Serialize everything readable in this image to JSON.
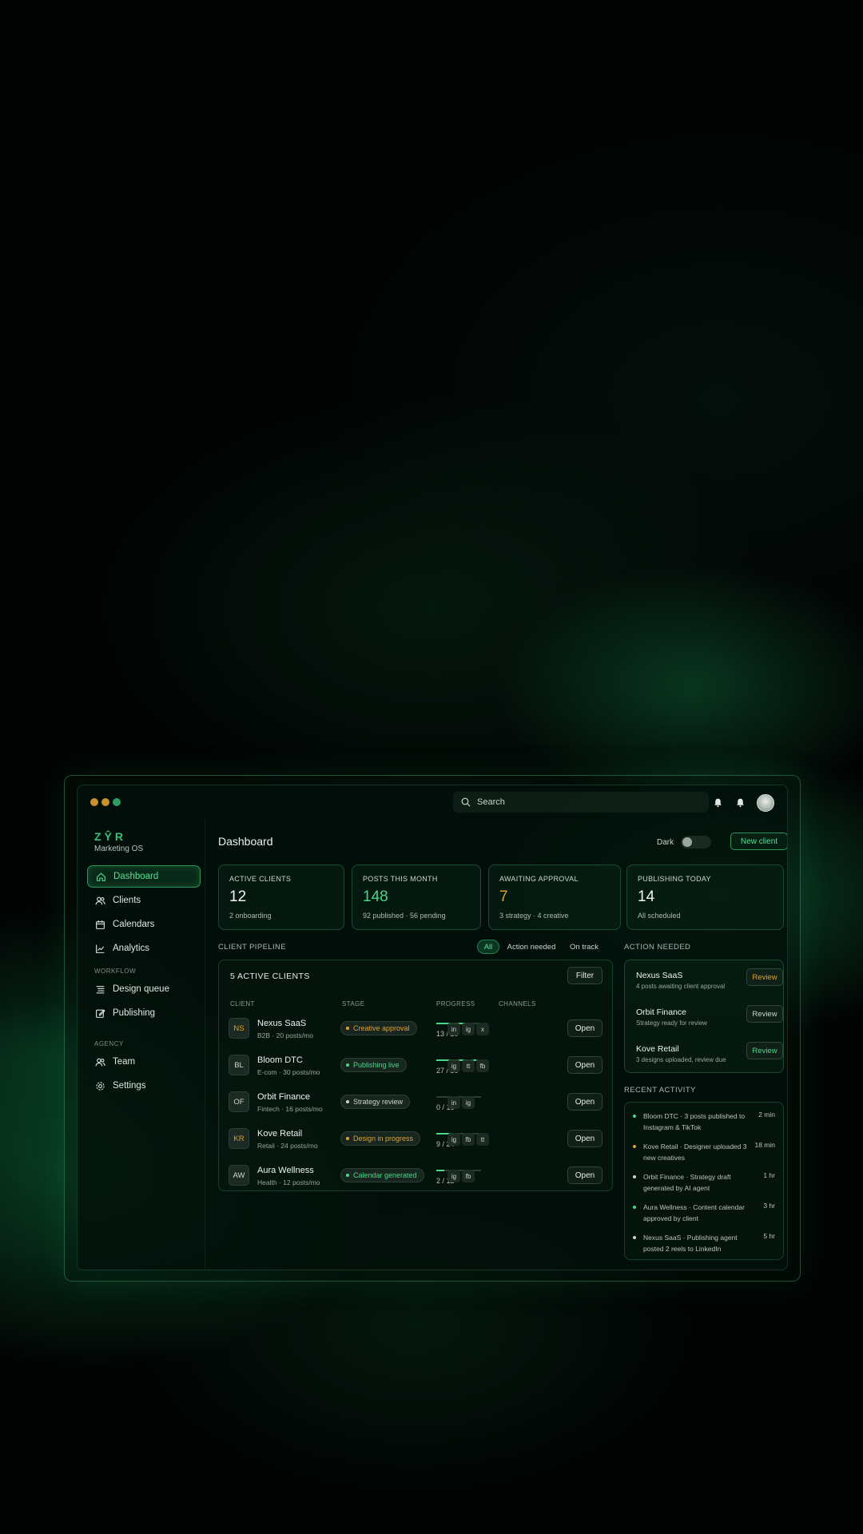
{
  "window": {
    "traffic_lights": [
      "#c8902a",
      "#c8902a",
      "#2f9e63"
    ],
    "search_placeholder": "Search"
  },
  "sidebar": {
    "brand": "ZŶR",
    "brand_sub": "Marketing OS",
    "items": [
      {
        "label": "Dashboard",
        "icon": "home-icon"
      },
      {
        "label": "Clients",
        "icon": "users-icon"
      },
      {
        "label": "Calendars",
        "icon": "calendar-icon"
      },
      {
        "label": "Analytics",
        "icon": "chart-line-icon"
      }
    ],
    "workflow_label": "WORKFLOW",
    "workflow_items": [
      {
        "label": "Design queue",
        "icon": "list-icon"
      },
      {
        "label": "Publishing",
        "icon": "edit-icon"
      }
    ],
    "agency_label": "AGENCY",
    "agency_items": [
      {
        "label": "Team",
        "icon": "users-icon"
      },
      {
        "label": "Settings",
        "icon": "gear-icon"
      }
    ]
  },
  "header": {
    "title": "Dashboard",
    "theme_label": "Dark",
    "new_client_label": "New client"
  },
  "stats": [
    {
      "label": "ACTIVE CLIENTS",
      "value": "12",
      "sub": "2 onboarding",
      "color": "#f0f5f2"
    },
    {
      "label": "POSTS THIS MONTH",
      "value": "148",
      "sub": "92 published · 56 pending",
      "color": "#49d68a"
    },
    {
      "label": "AWAITING APPROVAL",
      "value": "7",
      "sub": "3 strategy · 4 creative",
      "color": "#e0a030"
    },
    {
      "label": "PUBLISHING TODAY",
      "value": "14",
      "sub": "All scheduled",
      "color": "#f0f5f2"
    }
  ],
  "pipeline": {
    "section_label": "CLIENT PIPELINE",
    "tabs": [
      "All",
      "Action needed",
      "On track"
    ],
    "title": "5 ACTIVE CLIENTS",
    "filter_label": "Filter",
    "columns": [
      "CLIENT",
      "STAGE",
      "PROGRESS",
      "CHANNELS"
    ],
    "open_label": "Open",
    "rows": [
      {
        "initials": "NS",
        "name": "Nexus SaaS",
        "meta": "B2B · 20 posts/mo",
        "stage": "Creative approval",
        "stage_color": "#e0a030",
        "progress_text": "13 / 20",
        "progress": 0.65,
        "channels": [
          "in",
          "ig",
          "x"
        ]
      },
      {
        "initials": "BL",
        "name": "Bloom DTC",
        "meta": "E-com · 30 posts/mo",
        "stage": "Publishing live",
        "stage_color": "#49d68a",
        "progress_text": "27 / 30",
        "progress": 0.9,
        "channels": [
          "ig",
          "tt",
          "fb"
        ]
      },
      {
        "initials": "OF",
        "name": "Orbit Finance",
        "meta": "Fintech · 16 posts/mo",
        "stage": "Strategy review",
        "stage_color": "#c9d6ce",
        "progress_text": "0 / 16",
        "progress": 0.0,
        "channels": [
          "in",
          "ig"
        ]
      },
      {
        "initials": "KR",
        "name": "Kove Retail",
        "meta": "Retail · 24 posts/mo",
        "stage": "Design in progress",
        "stage_color": "#e0a030",
        "progress_text": "9 / 24",
        "progress": 0.375,
        "channels": [
          "ig",
          "fb",
          "tt"
        ]
      },
      {
        "initials": "AW",
        "name": "Aura Wellness",
        "meta": "Health · 12 posts/mo",
        "stage": "Calendar generated",
        "stage_color": "#49d68a",
        "progress_text": "2 / 12",
        "progress": 0.17,
        "channels": [
          "ig",
          "fb"
        ]
      }
    ]
  },
  "action_needed": {
    "section_label": "ACTION NEEDED",
    "items": [
      {
        "name": "Nexus SaaS",
        "desc": "4 posts awaiting client approval",
        "button": "Review",
        "color": "#e0a030"
      },
      {
        "name": "Orbit Finance",
        "desc": "Strategy ready for review",
        "button": "Review",
        "color": "#c9d6ce"
      },
      {
        "name": "Kove Retail",
        "desc": "3 designs uploaded, review due",
        "button": "Review",
        "color": "#49d68a"
      }
    ]
  },
  "activity": {
    "section_label": "RECENT ACTIVITY",
    "items": [
      {
        "text": "Bloom DTC · 3 posts published to Instagram & TikTok",
        "time": "2 min",
        "color": "#49d68a"
      },
      {
        "text": "Kove Retail · Designer uploaded 3 new creatives",
        "time": "18 min",
        "color": "#e0a030"
      },
      {
        "text": "Orbit Finance · Strategy draft generated by AI agent",
        "time": "1 hr",
        "color": "#c9d6ce"
      },
      {
        "text": "Aura Wellness · Content calendar approved by client",
        "time": "3 hr",
        "color": "#49d68a"
      },
      {
        "text": "Nexus SaaS · Publishing agent posted 2 reels to LinkedIn",
        "time": "5 hr",
        "color": "#c9d6ce"
      }
    ]
  }
}
